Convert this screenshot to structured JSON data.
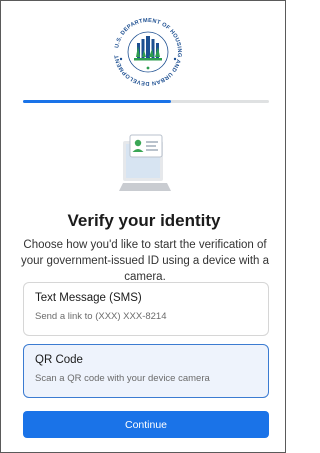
{
  "header": {
    "seal_text": "U.S. DEPARTMENT OF HOUSING AND URBAN DEVELOPMENT",
    "progress_fraction": 0.6
  },
  "heading": "Verify your identity",
  "description": "Choose how you'd like to start the verification of your government-issued ID using a device with a camera.",
  "options": [
    {
      "title": "Text Message (SMS)",
      "subtitle": "Send a link to (XXX) XXX-8214",
      "selected": false
    },
    {
      "title": "QR Code",
      "subtitle": "Scan a QR code with your device camera",
      "selected": true
    }
  ],
  "continue_label": "Continue",
  "colors": {
    "primary": "#1a73e8",
    "seal_blue": "#1d4f91",
    "seal_green": "#2e9d4f",
    "selected_bg": "#eef3fc",
    "selected_border": "#3b7bd1"
  }
}
